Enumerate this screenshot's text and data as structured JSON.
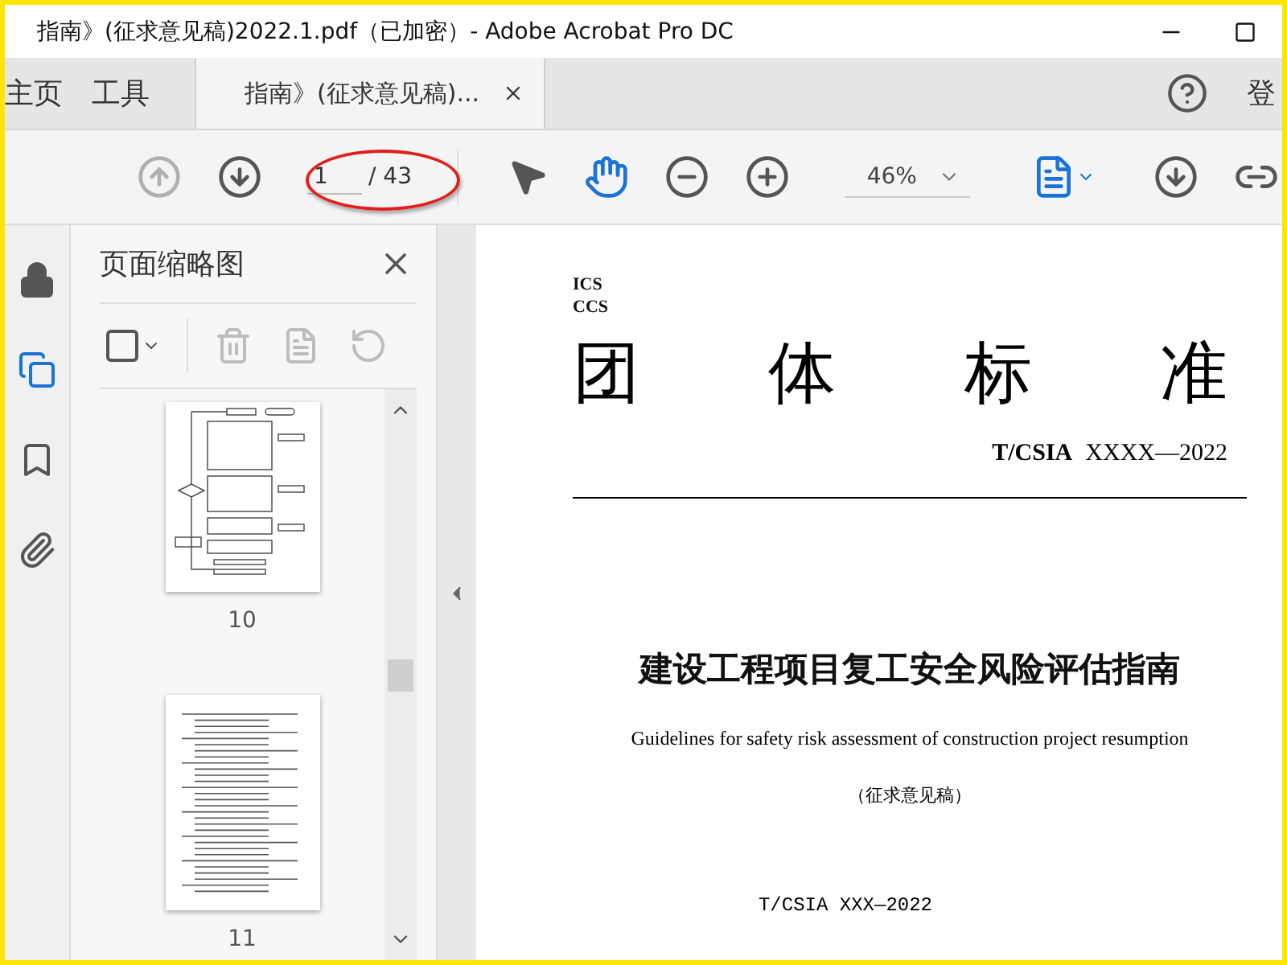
{
  "window": {
    "title": "指南》(征求意见稿)2022.1.pdf（已加密）- Adobe Acrobat Pro DC"
  },
  "tabs": [
    {
      "label": "主页",
      "selected": false
    },
    {
      "label": "工具",
      "selected": false
    },
    {
      "label": "指南》(征求意见稿)...",
      "selected": true
    }
  ],
  "account_label": "登",
  "toolbar": {
    "nav": [
      {
        "kind": "prev",
        "disabled": true
      },
      {
        "kind": "next",
        "disabled": false
      }
    ],
    "page_current": "1",
    "page_total": "/ 43",
    "tools": [
      {
        "kind": "select",
        "selected": false
      },
      {
        "kind": "hand",
        "selected": true
      }
    ],
    "zoom": "46%"
  },
  "side_rail": [
    {
      "kind": "lock",
      "selected": false
    },
    {
      "kind": "pages",
      "selected": true
    },
    {
      "kind": "bookmark",
      "selected": false
    },
    {
      "kind": "attachment",
      "selected": false
    }
  ],
  "thumbnail_panel": {
    "title": "页面缩略图",
    "actions": [
      {
        "kind": "delete",
        "disabled": true
      },
      {
        "kind": "extract",
        "disabled": true
      },
      {
        "kind": "rotate",
        "disabled": true
      }
    ],
    "thumbnails": [
      {
        "page": "10",
        "kind": "flowchart"
      },
      {
        "page": "11",
        "kind": "text"
      }
    ]
  },
  "document": {
    "ics": "ICS",
    "ccs": "CCS",
    "heading": [
      "团",
      "体",
      "标",
      "准"
    ],
    "code_prefix": "T/CSIA",
    "code": "XXXX—2022",
    "title": "建设工程项目复工安全风险评估指南",
    "subtitle": "Guidelines for safety risk assessment of construction project resumption",
    "status": "（征求意见稿）",
    "footer": "T/CSIA XXX—2022"
  }
}
